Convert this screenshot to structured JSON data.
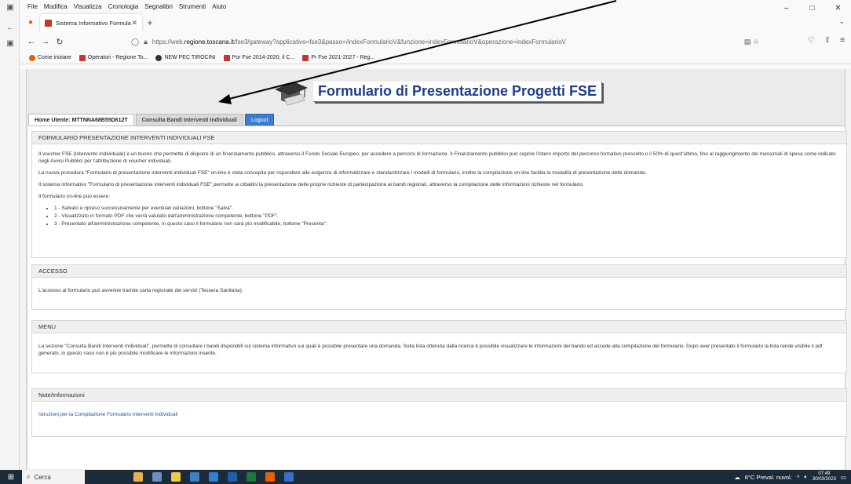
{
  "menubar": [
    "File",
    "Modifica",
    "Visualizza",
    "Cronologia",
    "Segnalibri",
    "Strumenti",
    "Aiuto"
  ],
  "window_controls": [
    "–",
    "□",
    "✕"
  ],
  "browser_tab": {
    "title": "Sistema Informativo Formulario",
    "close": "✕"
  },
  "newtab": "+",
  "url": {
    "prefix": "https://web.",
    "host": "regione.toscana.it",
    "path": "/fse3/gateway?applicativo=fse3&passo=/indexFormularioV&funzione=indexFormularioV&operazione=indexFormularioV"
  },
  "bookmarks": [
    {
      "label": "Come iniziare",
      "color": "#e66000"
    },
    {
      "label": "Operatori - Regione To...",
      "color": "#c0392b"
    },
    {
      "label": "NEW PEC TIROCINI",
      "color": "#333333"
    },
    {
      "label": "Por Fse 2014-2020, il C...",
      "color": "#c0392b"
    },
    {
      "label": "Pr Fse 2021-2027 - Reg...",
      "color": "#c0392b"
    }
  ],
  "app_title": "Formulario di Presentazione Progetti FSE",
  "tabs": {
    "home": "Home Utente: MTTNNA68B55D612T",
    "consulta": "Consulta Bandi Interventi Individuali",
    "logout": "Logout"
  },
  "sections": {
    "formulario": {
      "title": "FORMULARIO PRESENTAZIONE INTERVENTI INDIVIDUALI FSE",
      "p1": "Il voucher FSE (Intervento Individuale) è un buono che permette di disporre di un finanziamento pubblico, attraverso il Fondo Sociale Europeo, per accedere a percorsi di formazione. Il Finanziamento pubblico può coprire l'intero importo del percorso formativo prescelto o il 50% di quest'ultimo, fino al raggiungimento dei massimali di spesa come indicato negli Avvisi Pubblici per l'attribuzione di voucher individuali.",
      "p2": "La nuova procedura \"Formulario di presentazione interventi individuali FSE\" on-line è stata concepita per rispondere alle esigenze di informatizzare e standardizzare i modelli di formulario, inoltre la compilazione on-line facilita la modalità di presentazione delle domande.",
      "p3": "Il sistema informativo \"Formulario di presentazione interventi individuali FSE\" permette ai cittadini la presentazione delle proprie richieste di partecipazione ai bandi regionali, attraverso la compilazione delle informazioni richieste nel formulario.",
      "p4": "Il formulario on-line può essere:",
      "items": [
        "1 - Salvato e ripreso successivamente per eventuali variazioni, bottone \"Salva\".",
        "2 - Visualizzato in formato PDF che verrà valutato dall'amministrazione competente, bottone \"PDF\".",
        "3 - Presentato all'amministrazione competente, in questo caso il formulario non sarà più modificabile, bottone \"Presenta\"."
      ]
    },
    "accesso": {
      "title": "ACCESSO",
      "p1": "L'accesso al formulario può avvenire tramite carta regionale dei servizi (Tessera Sanitaria)."
    },
    "menu": {
      "title": "MENU",
      "p1": "La sezione \"Consulta Bandi Interventi Individuali\", permette di consultare i bandi disponibili sul sistema informativo sui quali è possibile presentare una domanda. Sulla lista ottenuta dalla ricerca è possibile visualizzare le informazioni del bando ed accede alla compilazione del formulario. Dopo aver presentato il formulario la lista rende visibile il pdf generato, in questo caso non è più possibile modificare le informazioni inserite."
    },
    "note": {
      "title": "Note/Informazioni",
      "link": "Istruzioni per la Compilazione Formulario Interventi Individuali"
    }
  },
  "taskbar": {
    "search": "Cerca",
    "weather": "8°C  Preval. nuvol.",
    "time": "07:49",
    "date": "30/03/2023"
  }
}
